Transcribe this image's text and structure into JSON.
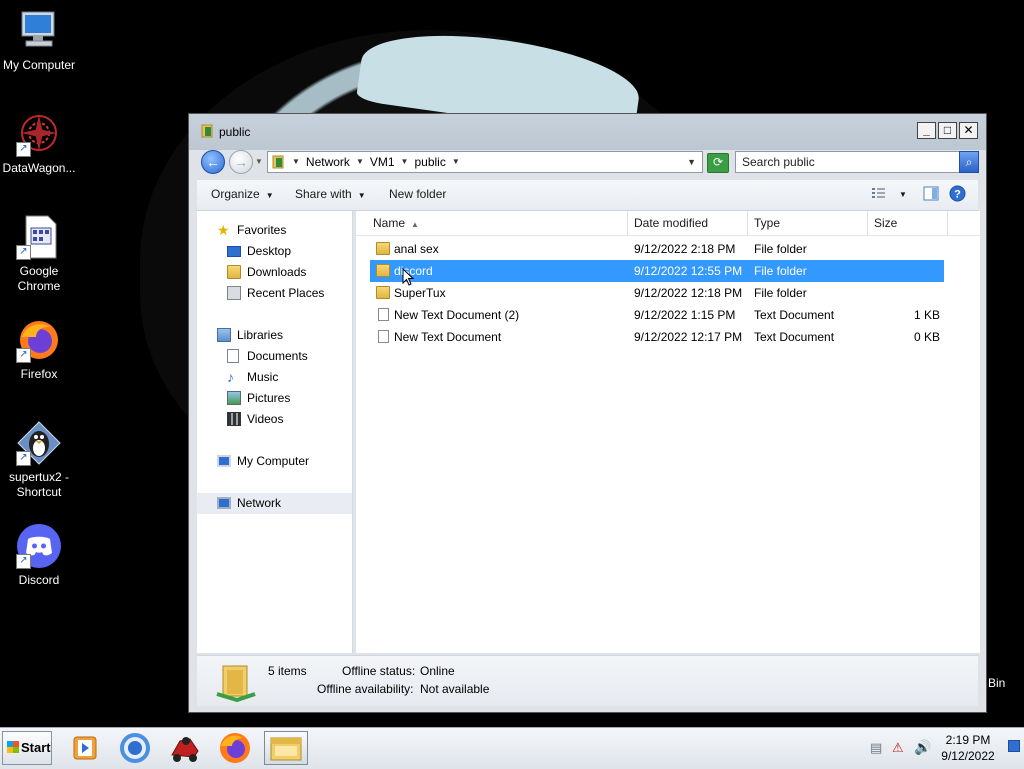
{
  "desktop": {
    "icons": [
      {
        "label": "My Computer"
      },
      {
        "label": "DataWagon..."
      },
      {
        "label": "Google Chrome"
      },
      {
        "label": "Firefox"
      },
      {
        "label": "supertux2 - Shortcut"
      },
      {
        "label": "Discord"
      }
    ],
    "recycle_bin_label": "Bin"
  },
  "window": {
    "title": "public",
    "controls": {
      "minimize": "_",
      "maximize": "□",
      "close": "✕"
    },
    "address": {
      "crumbs": [
        "Network",
        "VM1",
        "public"
      ]
    },
    "search": {
      "placeholder": "Search public"
    },
    "commands": {
      "organize": "Organize",
      "share_with": "Share with",
      "new_folder": "New folder"
    },
    "nav": {
      "favorites": "Favorites",
      "desktop": "Desktop",
      "downloads": "Downloads",
      "recent_places": "Recent Places",
      "libraries": "Libraries",
      "documents": "Documents",
      "music": "Music",
      "pictures": "Pictures",
      "videos": "Videos",
      "my_computer": "My Computer",
      "network": "Network"
    },
    "columns": {
      "name": "Name",
      "date": "Date modified",
      "type": "Type",
      "size": "Size"
    },
    "files": [
      {
        "name": "anal sex",
        "date": "9/12/2022 2:18 PM",
        "type": "File folder",
        "size": "",
        "kind": "folder"
      },
      {
        "name": "discord",
        "date": "9/12/2022 12:55 PM",
        "type": "File folder",
        "size": "",
        "kind": "folder",
        "selected": true
      },
      {
        "name": "SuperTux",
        "date": "9/12/2022 12:18 PM",
        "type": "File folder",
        "size": "",
        "kind": "folder"
      },
      {
        "name": "New Text Document (2)",
        "date": "9/12/2022 1:15 PM",
        "type": "Text Document",
        "size": "1 KB",
        "kind": "document"
      },
      {
        "name": "New Text Document",
        "date": "9/12/2022 12:17 PM",
        "type": "Text Document",
        "size": "0 KB",
        "kind": "document"
      }
    ],
    "details": {
      "item_count": "5 items",
      "offline_status_label": "Offline status:",
      "offline_status_value": "Online",
      "offline_availability_label": "Offline availability:",
      "offline_availability_value": "Not available"
    }
  },
  "taskbar": {
    "start_label": "Start",
    "apps": [
      "media-player-icon",
      "chrome-icon",
      "supertux-icon",
      "firefox-icon",
      "explorer-icon"
    ],
    "clock_time": "2:19 PM",
    "clock_date": "9/12/2022"
  },
  "colors": {
    "selection": "#3399ff",
    "desktop": "#000000"
  }
}
